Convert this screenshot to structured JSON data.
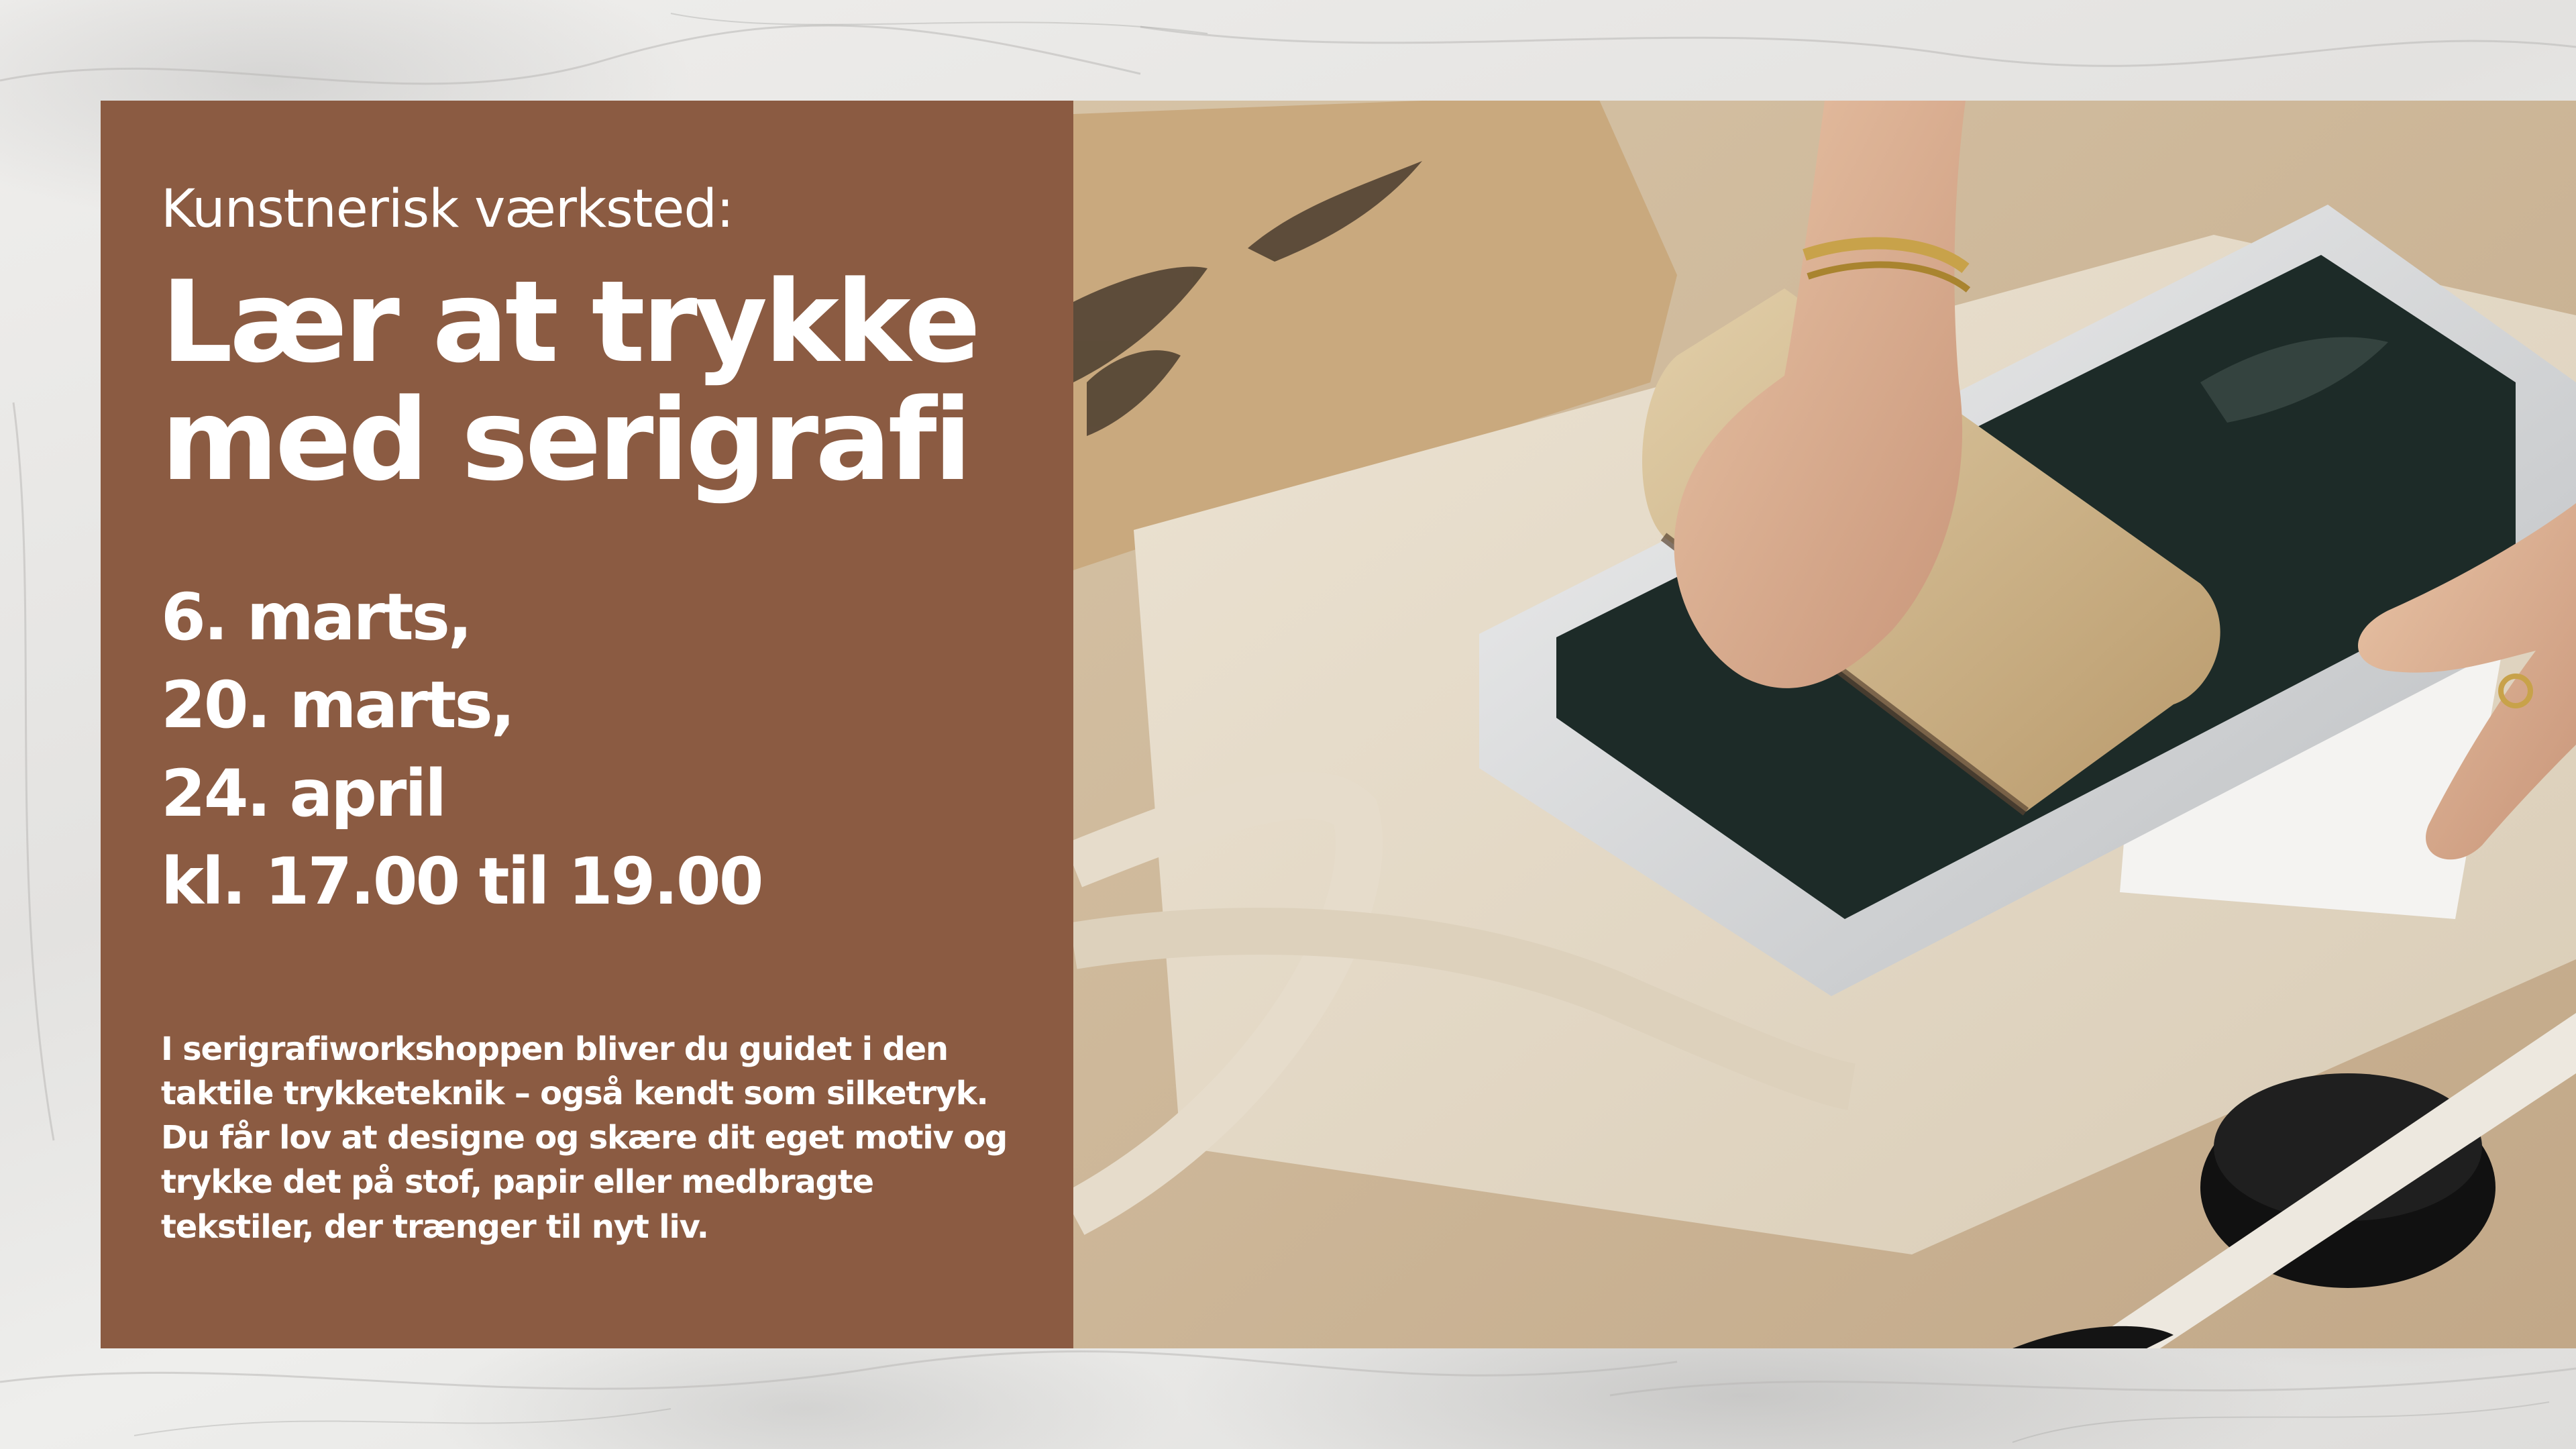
{
  "poster": {
    "kicker": "Kunstnerisk værksted:",
    "title_line1": "Lær at trykke",
    "title_line2": "med serigrafi",
    "dates": [
      "6. marts,",
      "20. marts,",
      "24. april",
      "kl. 17.00 til 19.00"
    ],
    "description": "I serigrafiworkshoppen bliver du guidet i den taktile trykketeknik – også kendt som silketryk. Du får lov at designe og skære dit eget motiv og trykke det på stof, papir eller medbragte tekstiler, der trænger til nyt liv."
  },
  "colors": {
    "panel": "#8b5b42",
    "text": "#ffffff",
    "background": "#e9e8e6"
  },
  "photo": {
    "subject": "screen-printing-photo"
  }
}
